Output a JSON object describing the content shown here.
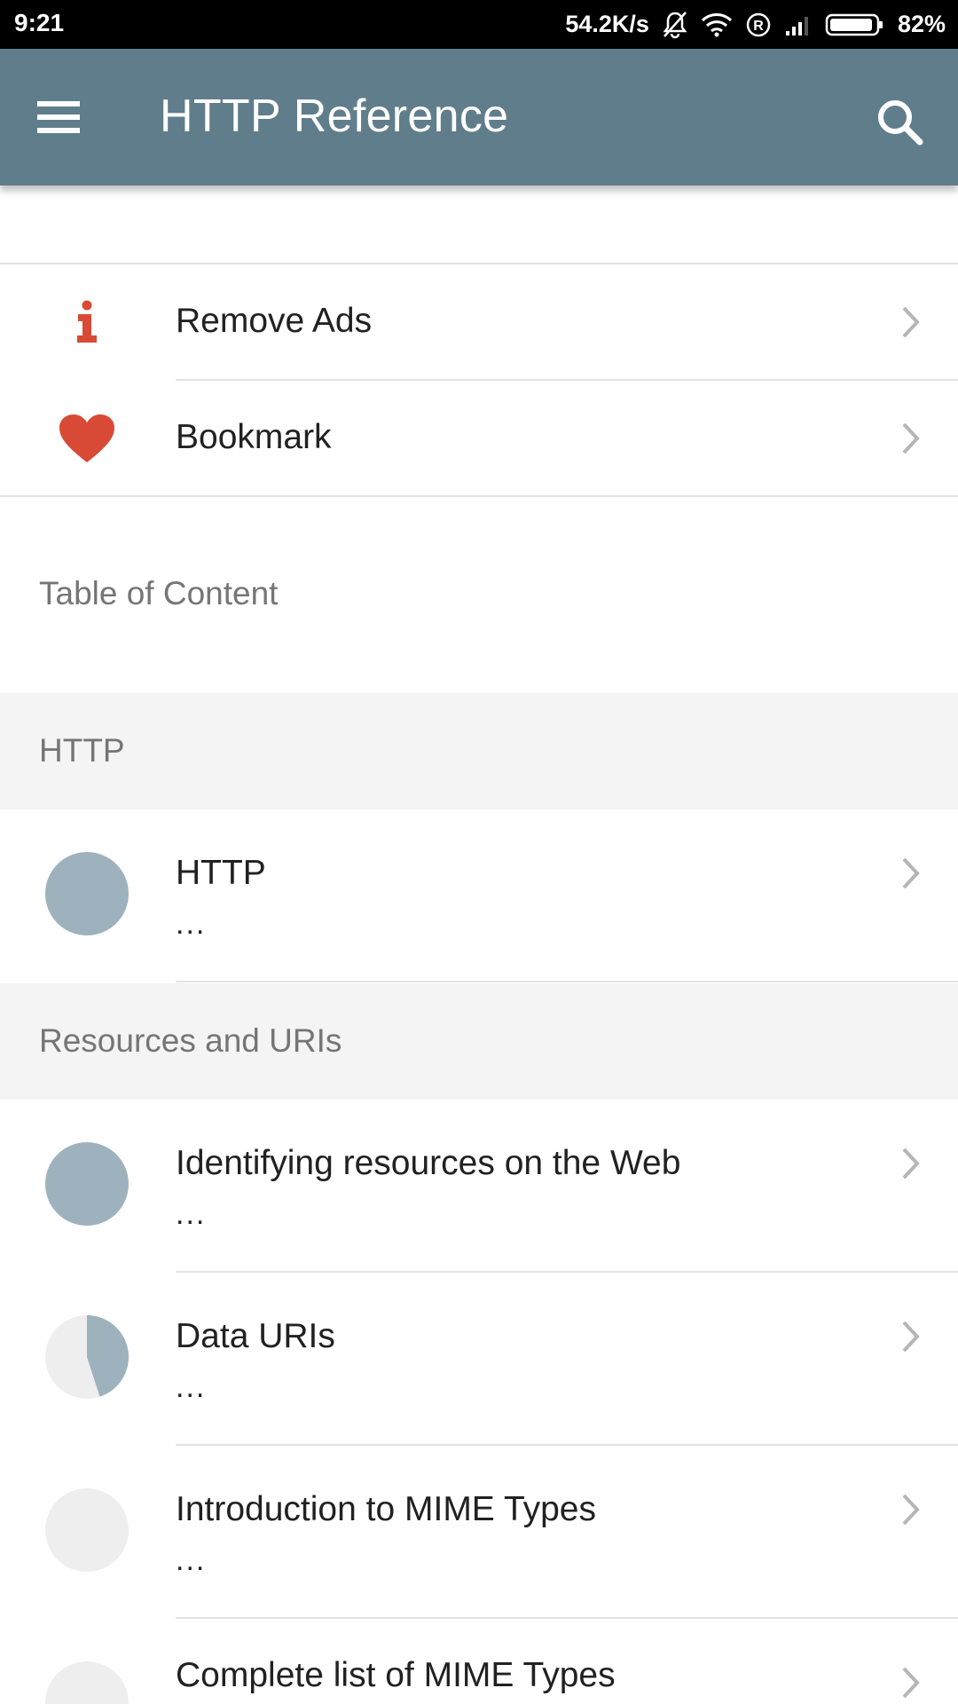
{
  "status_bar": {
    "time": "9:21",
    "network_speed": "54.2K/s",
    "battery_percent": "82%",
    "icons": [
      "mute-bell-icon",
      "wifi-icon",
      "registered-icon",
      "signal-icon",
      "battery-icon"
    ]
  },
  "app_bar": {
    "title": "HTTP Reference",
    "background_color": "#607d8b",
    "menu_icon": "hamburger-menu-icon",
    "search_icon": "search-icon"
  },
  "quick_actions": [
    {
      "label": "Remove Ads",
      "icon": "info-icon",
      "icon_color": "#d84a35"
    },
    {
      "label": "Bookmark",
      "icon": "heart-icon",
      "icon_color": "#d84a35"
    }
  ],
  "toc_heading": "Table of Content",
  "sections": [
    {
      "title": "HTTP",
      "items": [
        {
          "title": "HTTP",
          "subtitle": "...",
          "progress": 1.0
        }
      ]
    },
    {
      "title": "Resources and URIs",
      "items": [
        {
          "title": "Identifying resources on the Web",
          "subtitle": "...",
          "progress": 1.0
        },
        {
          "title": "Data URIs",
          "subtitle": "...",
          "progress": 0.45
        },
        {
          "title": "Introduction to MIME Types",
          "subtitle": "...",
          "progress": 0.0
        },
        {
          "title": "Complete list of MIME Types",
          "subtitle": "...",
          "progress": 0.0
        }
      ]
    }
  ],
  "colors": {
    "accent_red": "#d84a35",
    "progress_fill": "#9eb2bd",
    "progress_track": "#eeeeee"
  }
}
